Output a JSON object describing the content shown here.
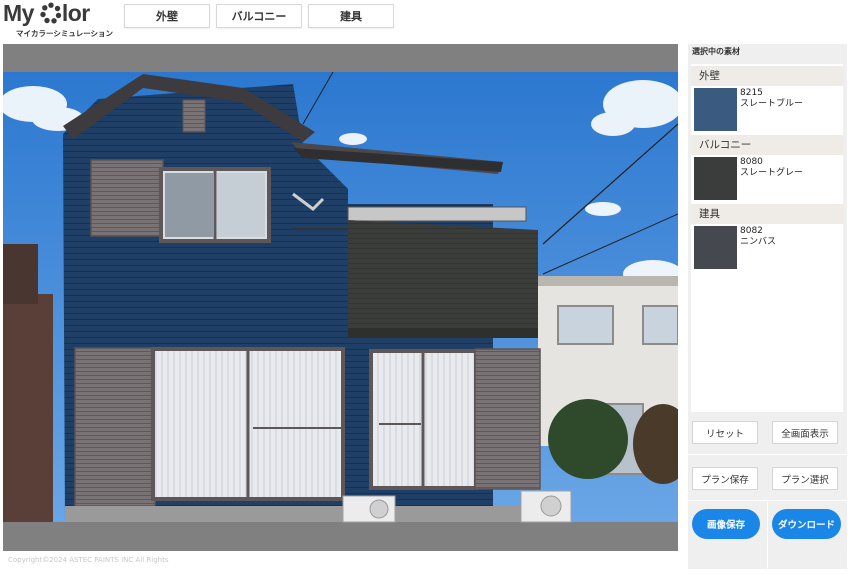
{
  "header": {
    "logo_text_1": "My",
    "logo_text_2": "lor",
    "logo_subtitle": "マイカラーシミュレーション",
    "tabs": [
      {
        "label": "外壁"
      },
      {
        "label": "バルコニー"
      },
      {
        "label": "建具"
      }
    ]
  },
  "panel": {
    "title": "選択中の素材",
    "sections": [
      {
        "label": "外壁",
        "code": "8215",
        "name": "スレートブルー",
        "color": "#3a5a80"
      },
      {
        "label": "バルコニー",
        "code": "8080",
        "name": "スレートグレー",
        "color": "#3a3d3c"
      },
      {
        "label": "建具",
        "code": "8082",
        "name": "ニンバス",
        "color": "#45484f"
      }
    ],
    "buttons": {
      "reset": "リセット",
      "fullscreen": "全画面表示",
      "save_plan": "プラン保存",
      "select_plan": "プラン選択",
      "save_image": "画像保存",
      "download": "ダウンロード"
    }
  },
  "footer": {
    "copyright": "Copyright©2024 ASTEC PAINTS INC All Rights"
  },
  "colors": {
    "accent": "#1a86e8",
    "wall": "#1f3f66",
    "balcony": "#3b3d3a",
    "fixtures": "#6b6468"
  }
}
